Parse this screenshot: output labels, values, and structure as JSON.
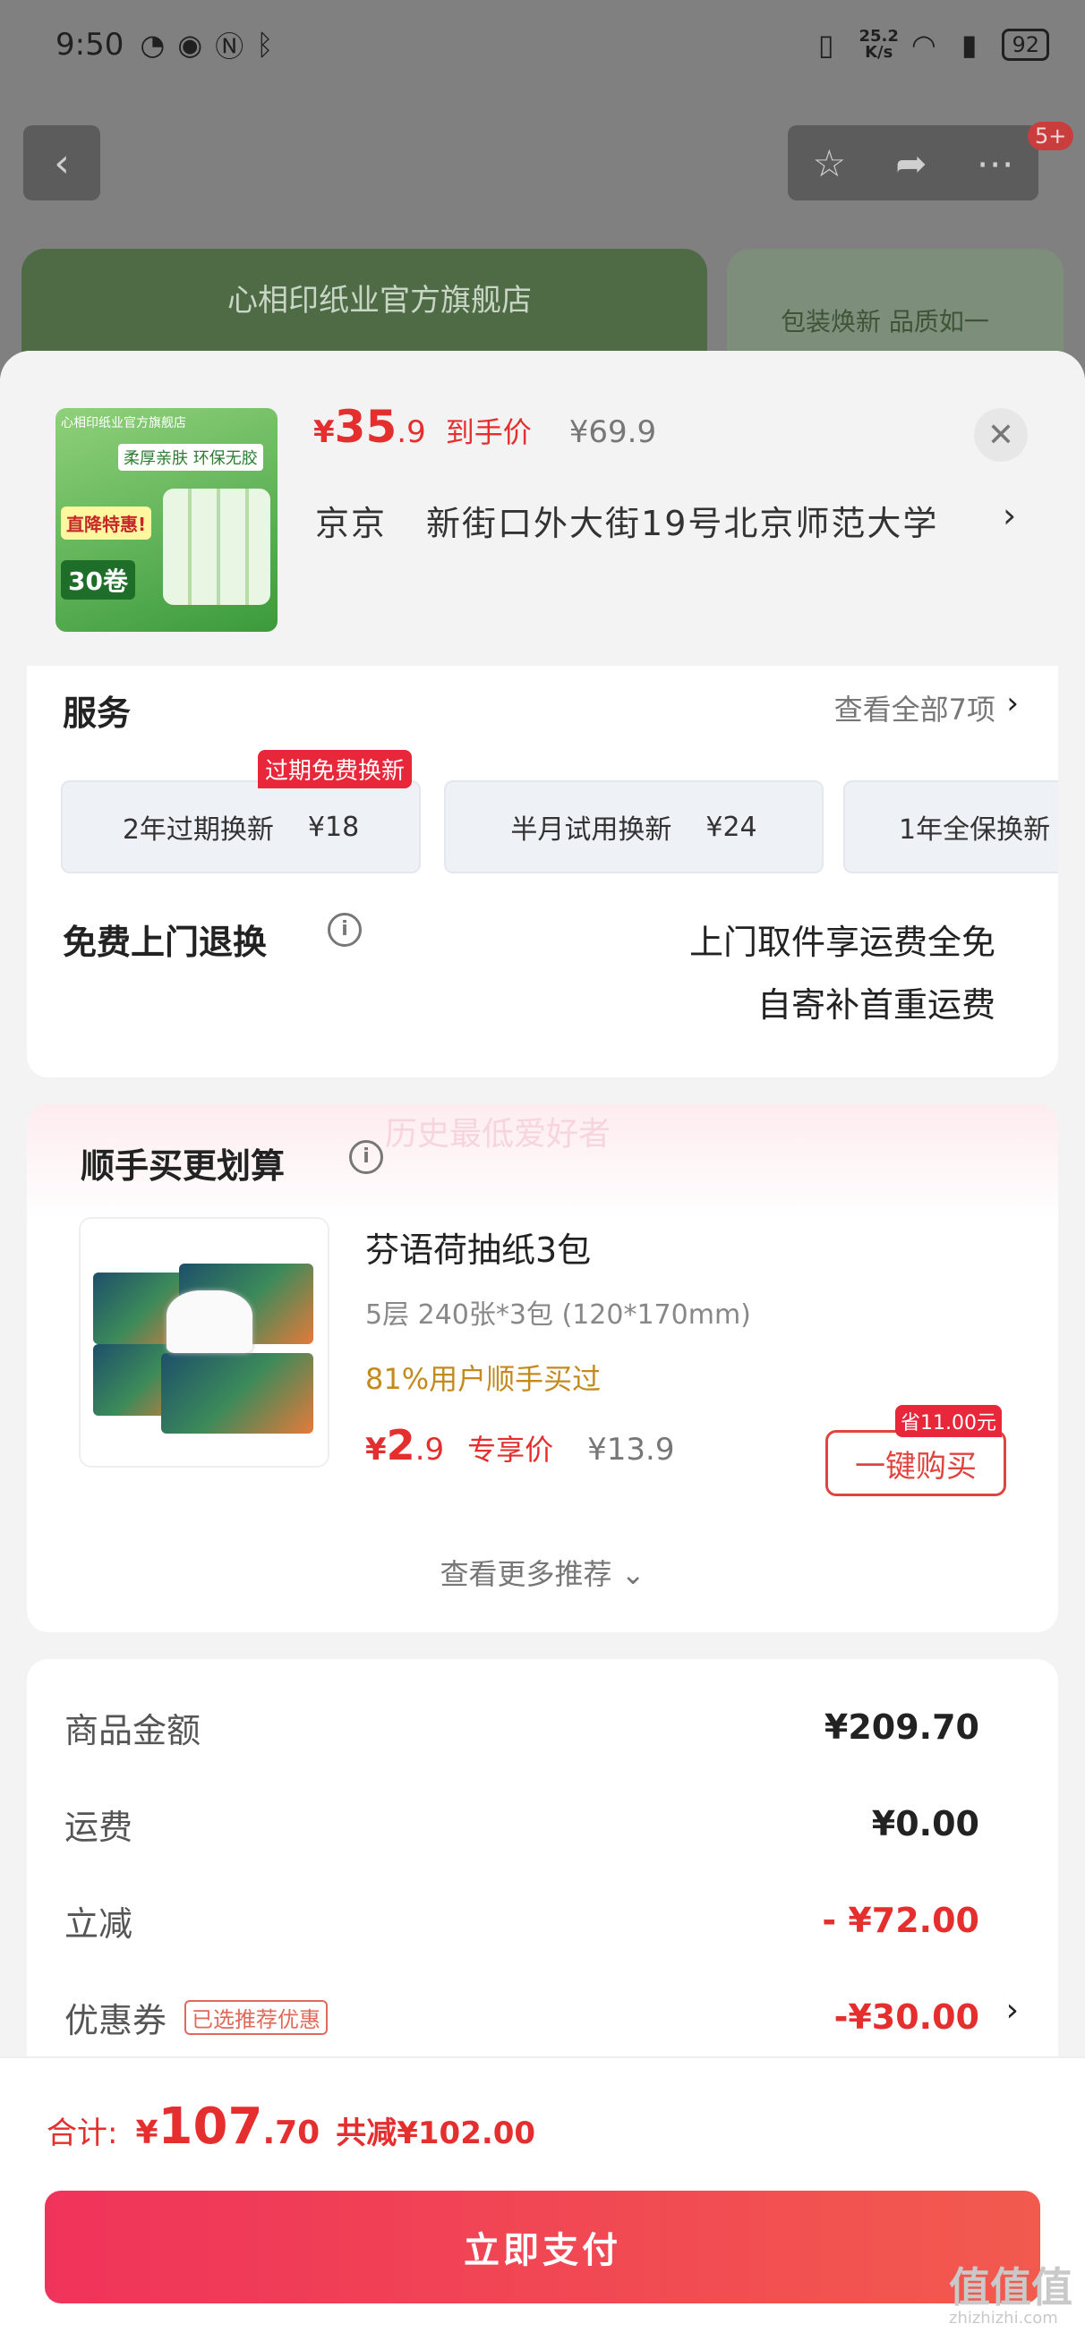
{
  "status_bar": {
    "time": "9:50",
    "speed_value": "25.2",
    "speed_unit": "K/s",
    "battery": "92"
  },
  "nav": {
    "badge": "5+"
  },
  "banner": {
    "store_name": "心相印纸业官方旗舰店",
    "slogan": "包装焕新 品质如一"
  },
  "product": {
    "thumb_store": "心相印纸业官方旗舰店",
    "thumb_tag": "柔厚亲肤 环保无胶",
    "thumb_promo": "直降特惠!",
    "thumb_count": "30卷",
    "price_currency": "¥",
    "price_int": "35",
    "price_dec": ".9",
    "price_label": "到手价",
    "original_price": "¥69.9",
    "close": "✕"
  },
  "address": {
    "city": "京京",
    "detail": "新街口外大街19号北京师范大学"
  },
  "services": {
    "title": "服务",
    "view_all": "查看全部7项",
    "tag": "过期免费换新",
    "options": [
      {
        "name": "2年过期换新",
        "price": "¥18"
      },
      {
        "name": "半月试用换新",
        "price": "¥24"
      },
      {
        "name": "1年全保换新",
        "price": ""
      }
    ]
  },
  "return_service": {
    "title": "免费上门退换",
    "line1": "上门取件享运费全免",
    "line2": "自寄补首重运费"
  },
  "bundle": {
    "watermark": "历史最低爱好者",
    "title": "顺手买更划算",
    "item_name": "芬语荷抽纸3包",
    "item_spec": "5层 240张*3包 (120*170mm)",
    "item_bought": "81%用户顺手买过",
    "price_currency": "¥",
    "price_int": "2",
    "price_dec": ".9",
    "price_label": "专享价",
    "original_price": "¥13.9",
    "save_tag": "省11.00元",
    "buy_label": "一键购买",
    "more_label": "查看更多推荐"
  },
  "summary": {
    "rows": [
      {
        "label": "商品金额",
        "value": "¥209.70"
      },
      {
        "label": "运费",
        "value": "¥0.00"
      },
      {
        "label": "立减",
        "value": "- ¥72.00"
      },
      {
        "label": "优惠券",
        "value": "-¥30.00",
        "tag": "已选推荐优惠"
      }
    ]
  },
  "footer": {
    "total_label": "合计:",
    "total_currency": "¥",
    "total_int": "107",
    "total_dec": ".70",
    "discount": "共减¥102.00",
    "pay_label": "立即支付"
  },
  "watermark": {
    "brand": "值值值",
    "url": "zhizhizhi.com"
  },
  "colors": {
    "accent": "#e52e2e",
    "pay_start": "#f0335a",
    "pay_end": "#f25a4e"
  }
}
